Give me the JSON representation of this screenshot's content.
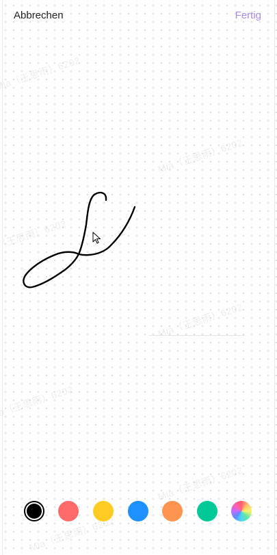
{
  "header": {
    "cancel_label": "Abbrechen",
    "done_label": "Fertig"
  },
  "watermark": {
    "text": "Mia（王思雨）6202"
  },
  "colors": {
    "accent": "#a78be8"
  },
  "palette": [
    {
      "name": "black",
      "color": "#000000",
      "selected": true
    },
    {
      "name": "red",
      "color": "#ff6b6b",
      "selected": false
    },
    {
      "name": "yellow",
      "color": "#ffcc24",
      "selected": false
    },
    {
      "name": "blue",
      "color": "#1e90ff",
      "selected": false
    },
    {
      "name": "orange",
      "color": "#ff9350",
      "selected": false
    },
    {
      "name": "green",
      "color": "#00c896",
      "selected": false
    },
    {
      "name": "rainbow",
      "color": "gradient",
      "selected": false
    }
  ]
}
